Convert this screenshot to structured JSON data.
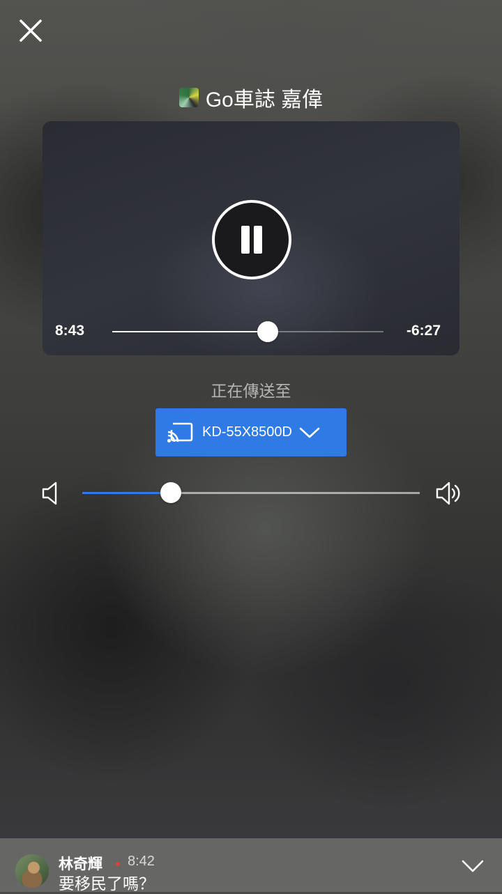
{
  "header": {
    "title": "Go車誌 嘉偉"
  },
  "player": {
    "elapsed": "8:43",
    "remaining": "-6:27",
    "progress": 0.574
  },
  "cast": {
    "label": "正在傳送至",
    "device_name": "KD-55X8500D"
  },
  "volume": {
    "level": 0.262
  },
  "comment": {
    "user": "林奇輝",
    "time": "8:42",
    "text": "要移民了嗎？"
  },
  "colors": {
    "accent": "#2f7ae5",
    "live_dot": "#e0413a"
  },
  "icons": [
    "close-icon",
    "channel-icon",
    "pause-icon",
    "cast-icon",
    "chevron-down-icon",
    "volume-low-icon",
    "volume-high-icon"
  ]
}
